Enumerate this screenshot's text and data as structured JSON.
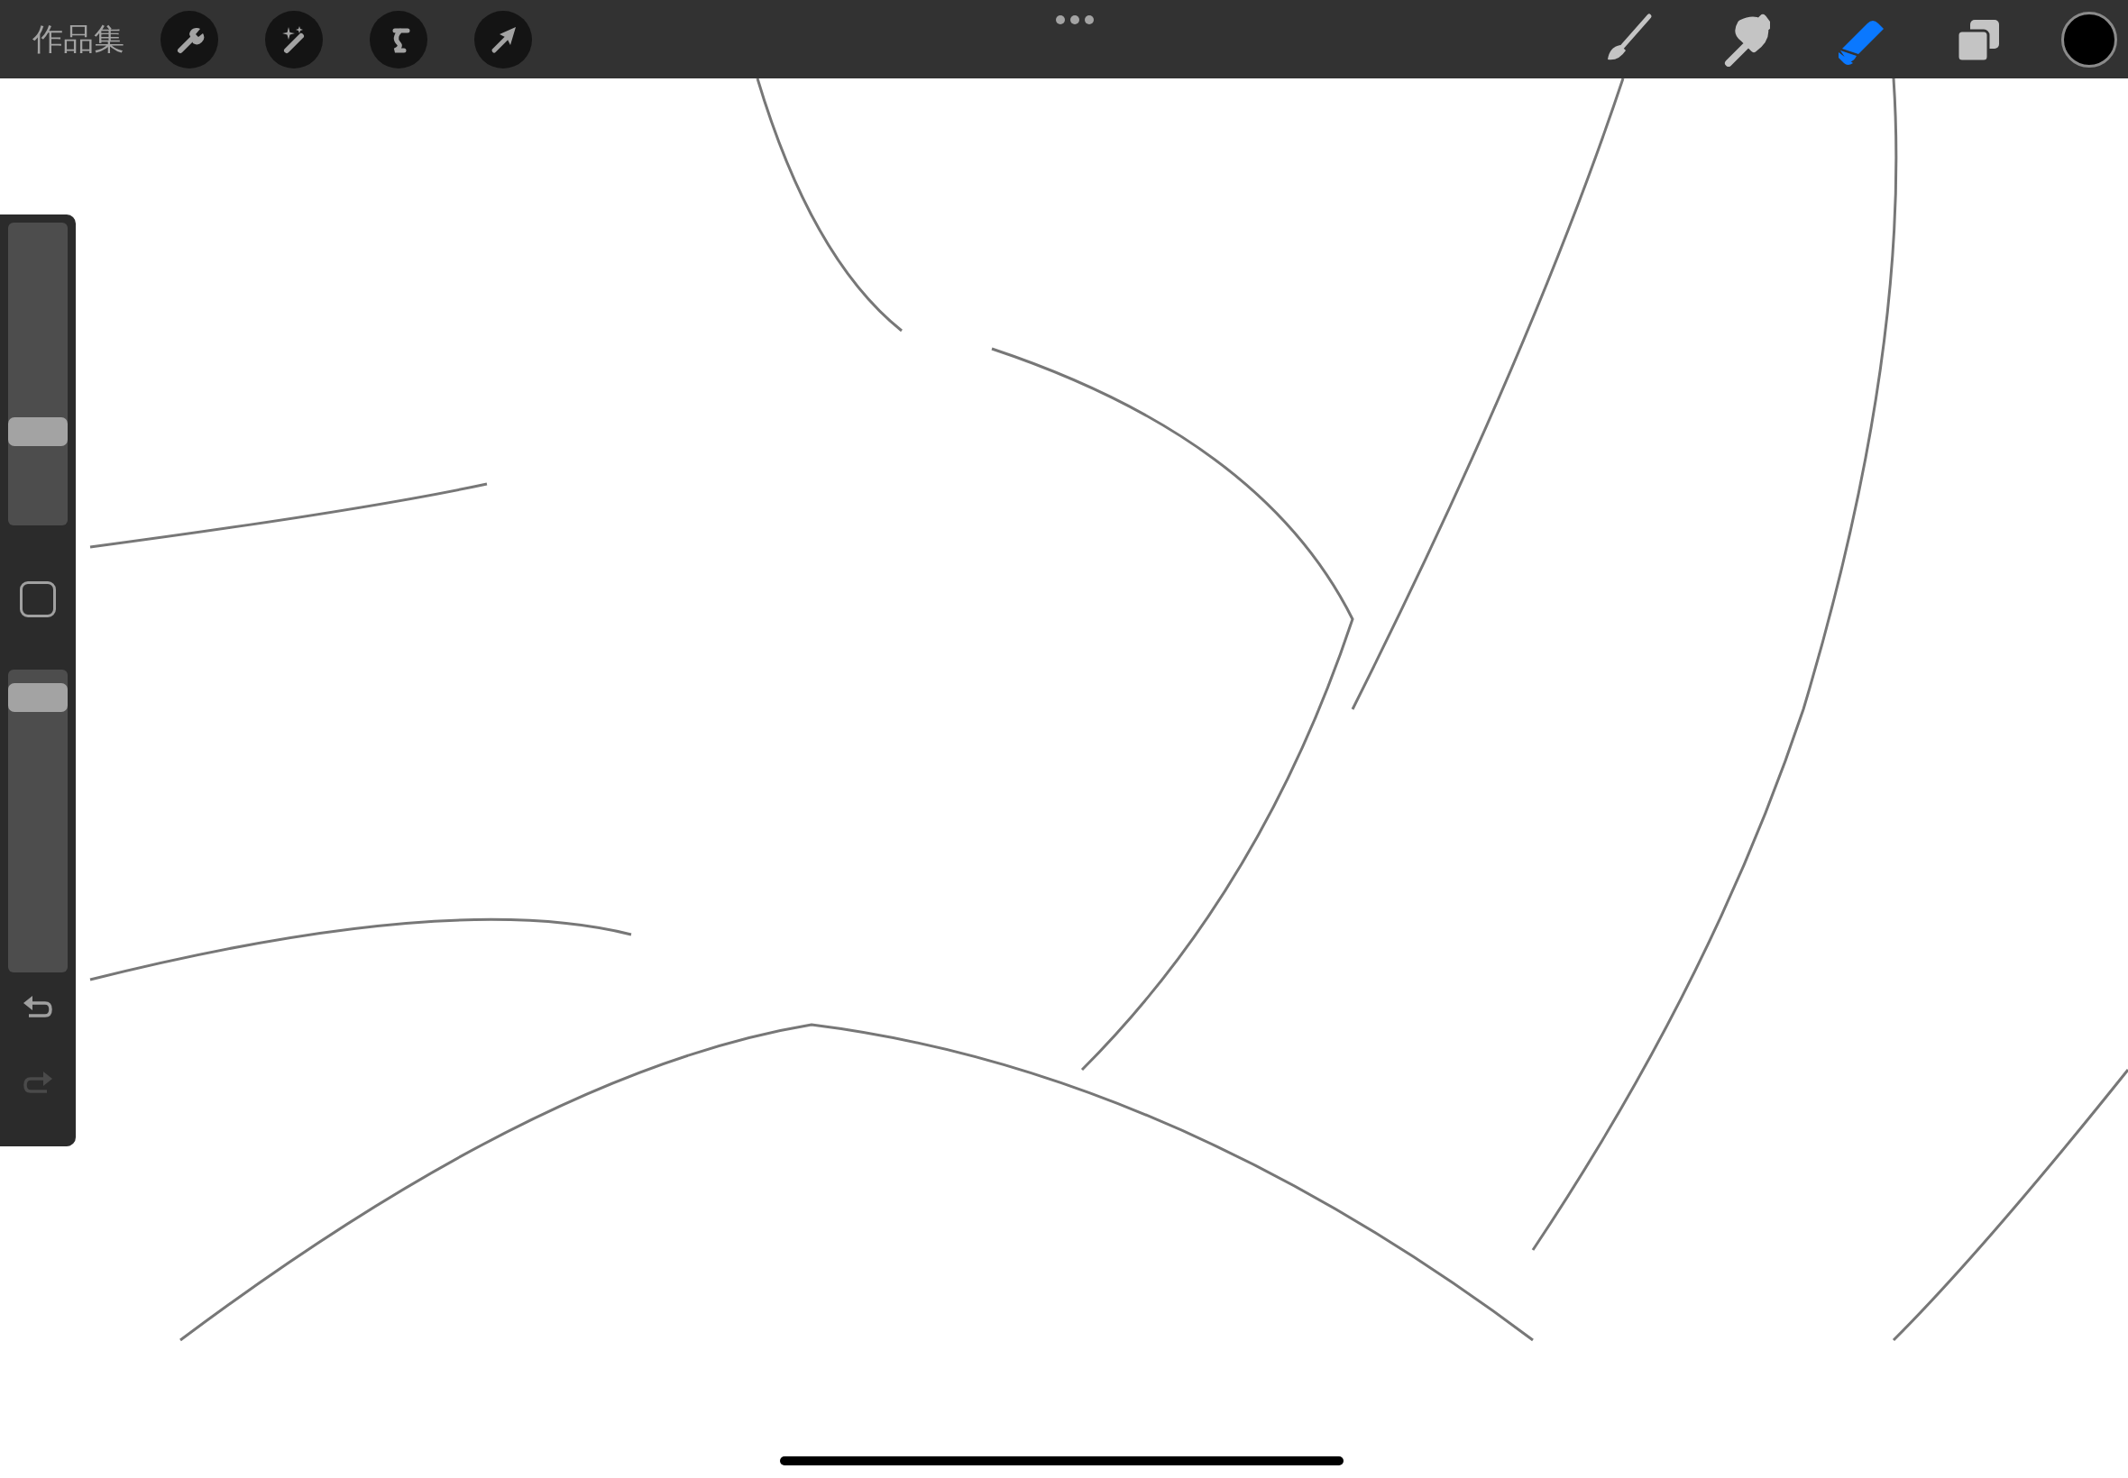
{
  "top_bar": {
    "gallery_label": "作品集"
  },
  "tools": [
    {
      "kind": "brush",
      "selected": false
    },
    {
      "kind": "smudge",
      "selected": false
    },
    {
      "kind": "eraser",
      "selected": true
    }
  ],
  "color_swatch": {
    "color": "#000000"
  },
  "sidebar": {
    "brush_size": {
      "level": 0.29
    },
    "opacity": {
      "level": 0.95
    },
    "redo": {
      "disabled": true
    }
  }
}
